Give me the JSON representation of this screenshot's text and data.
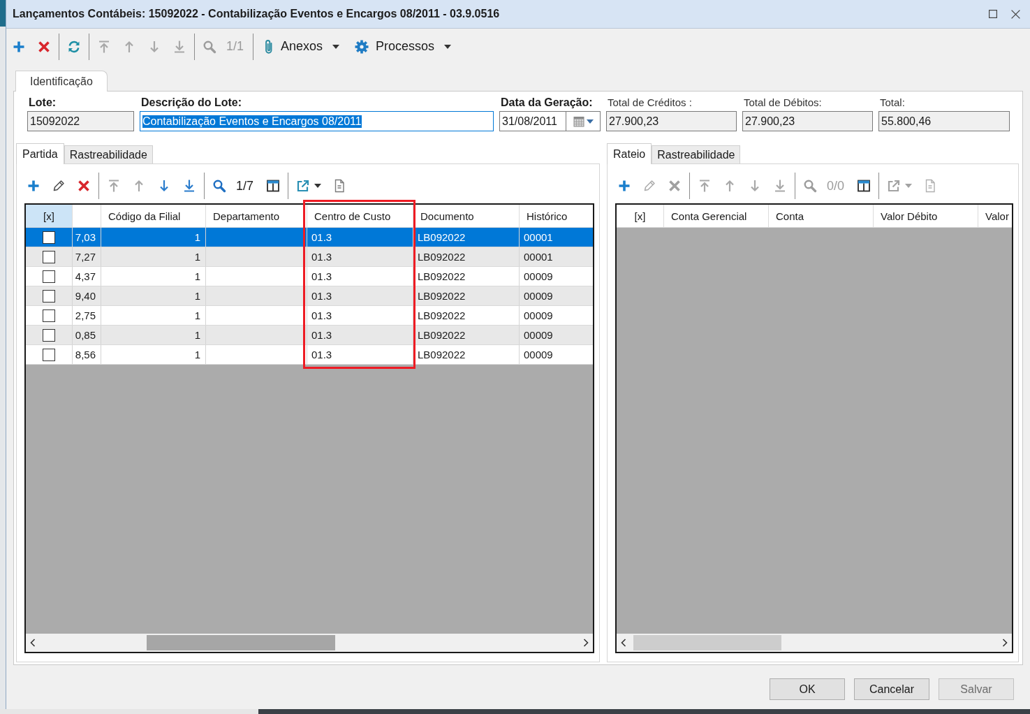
{
  "window": {
    "title": "Lançamentos Contábeis: 15092022 - Contabilização Eventos e Encargos 08/2011 - 03.9.0516"
  },
  "toolbar": {
    "items": [
      {
        "kind": "add",
        "disabled": false
      },
      {
        "kind": "delete",
        "disabled": false
      },
      {
        "kind": "separator"
      },
      {
        "kind": "refresh",
        "disabled": false
      },
      {
        "kind": "separator"
      },
      {
        "kind": "first",
        "disabled": true
      },
      {
        "kind": "previous",
        "disabled": true
      },
      {
        "kind": "next",
        "disabled": true
      },
      {
        "kind": "last",
        "disabled": true
      },
      {
        "kind": "separator"
      },
      {
        "kind": "search",
        "disabled": true
      },
      {
        "kind": "counter",
        "text": "1/1",
        "disabled": true
      },
      {
        "kind": "separator"
      },
      {
        "kind": "attachments",
        "label": "Anexos",
        "disabled": false
      },
      {
        "kind": "processes",
        "label": "Processos",
        "disabled": false
      }
    ]
  },
  "tabs": [
    {
      "label": "Identificação",
      "selected": true
    }
  ],
  "fields": [
    {
      "kind": "text",
      "label": "Lote:",
      "value": "15092022",
      "required": true,
      "readonly": true,
      "text_selected": false
    },
    {
      "kind": "text",
      "label": "Descrição do Lote:",
      "value": "Contabilização Eventos e Encargos 08/2011",
      "required": true,
      "readonly": false,
      "text_selected": true
    },
    {
      "kind": "date",
      "label": "Data da Geração:",
      "value": "31/08/2011",
      "required": true,
      "readonly": false,
      "text_selected": false
    },
    {
      "kind": "text",
      "label": "Total de Créditos :",
      "value": "27.900,23",
      "required": false,
      "readonly": true,
      "text_selected": false
    },
    {
      "kind": "text",
      "label": "Total de Débitos:",
      "value": "27.900,23",
      "required": false,
      "readonly": true,
      "text_selected": false
    },
    {
      "kind": "text",
      "label": "Total:",
      "value": "55.800,46",
      "required": false,
      "readonly": true,
      "text_selected": false
    }
  ],
  "left_panel": {
    "tabs": [
      {
        "label": "Partida",
        "selected": true
      },
      {
        "label": "Rastreabilidade",
        "selected": false
      }
    ],
    "toolbar": {
      "items": [
        {
          "kind": "add",
          "disabled": false
        },
        {
          "kind": "edit",
          "disabled": false
        },
        {
          "kind": "delete",
          "disabled": false
        },
        {
          "kind": "separator"
        },
        {
          "kind": "first",
          "disabled": true
        },
        {
          "kind": "previous",
          "disabled": true
        },
        {
          "kind": "next",
          "disabled": false
        },
        {
          "kind": "last",
          "disabled": false
        },
        {
          "kind": "separator"
        },
        {
          "kind": "search",
          "disabled": false
        },
        {
          "kind": "counter",
          "text": "1/7",
          "disabled": false
        },
        {
          "kind": "columns",
          "disabled": false
        },
        {
          "kind": "separator"
        },
        {
          "kind": "export",
          "disabled": false
        },
        {
          "kind": "document",
          "disabled": false
        }
      ]
    },
    "grid": {
      "columns": [
        {
          "label": "[x]",
          "selected": true,
          "highlighted": false
        },
        {
          "selected": false,
          "highlighted": false
        },
        {
          "label": "Código da Filial",
          "selected": false,
          "highlighted": false
        },
        {
          "label": "Departamento",
          "selected": false,
          "highlighted": false
        },
        {
          "label": "Centro de Custo",
          "selected": false,
          "highlighted": true
        },
        {
          "label": "Documento",
          "selected": false,
          "highlighted": false
        },
        {
          "label": "Histórico",
          "selected": false,
          "highlighted": false
        }
      ],
      "rows": [
        {
          "selected": true,
          "checked": false,
          "cells": [
            "",
            "7,03",
            "1",
            "",
            "01.3",
            "LB092022",
            "00001"
          ]
        },
        {
          "selected": false,
          "checked": false,
          "cells": [
            "",
            "7,27",
            "1",
            "",
            "01.3",
            "LB092022",
            "00001"
          ]
        },
        {
          "selected": false,
          "checked": false,
          "cells": [
            "",
            "4,37",
            "1",
            "",
            "01.3",
            "LB092022",
            "00009"
          ]
        },
        {
          "selected": false,
          "checked": false,
          "cells": [
            "",
            "9,40",
            "1",
            "",
            "01.3",
            "LB092022",
            "00009"
          ]
        },
        {
          "selected": false,
          "checked": false,
          "cells": [
            "",
            "2,75",
            "1",
            "",
            "01.3",
            "LB092022",
            "00009"
          ]
        },
        {
          "selected": false,
          "checked": false,
          "cells": [
            "",
            "0,85",
            "1",
            "",
            "01.3",
            "LB092022",
            "00009"
          ]
        },
        {
          "selected": false,
          "checked": false,
          "cells": [
            "",
            "8,56",
            "1",
            "",
            "01.3",
            "LB092022",
            "00009"
          ]
        }
      ]
    }
  },
  "right_panel": {
    "tabs": [
      {
        "label": "Rateio",
        "selected": true
      },
      {
        "label": "Rastreabilidade",
        "selected": false
      }
    ],
    "toolbar": {
      "items": [
        {
          "kind": "add",
          "disabled": false
        },
        {
          "kind": "edit",
          "disabled": true
        },
        {
          "kind": "delete",
          "disabled": true
        },
        {
          "kind": "separator"
        },
        {
          "kind": "first",
          "disabled": true
        },
        {
          "kind": "previous",
          "disabled": true
        },
        {
          "kind": "next",
          "disabled": true
        },
        {
          "kind": "last",
          "disabled": true
        },
        {
          "kind": "separator"
        },
        {
          "kind": "search",
          "disabled": true
        },
        {
          "kind": "counter",
          "text": "0/0",
          "disabled": true
        },
        {
          "kind": "columns",
          "disabled": false
        },
        {
          "kind": "separator"
        },
        {
          "kind": "export",
          "disabled": true
        },
        {
          "kind": "document",
          "disabled": true
        }
      ]
    },
    "grid": {
      "columns": [
        {
          "label": "[x]",
          "selected": false
        },
        {
          "label": "Conta Gerencial",
          "selected": false
        },
        {
          "label": "Conta",
          "selected": false
        },
        {
          "label": "Valor Débito",
          "selected": false
        },
        {
          "label": "Valor",
          "selected": false
        }
      ]
    }
  },
  "buttons": [
    {
      "label": "OK",
      "disabled": false
    },
    {
      "label": "Cancelar",
      "disabled": false
    },
    {
      "label": "Salvar",
      "disabled": true
    }
  ]
}
